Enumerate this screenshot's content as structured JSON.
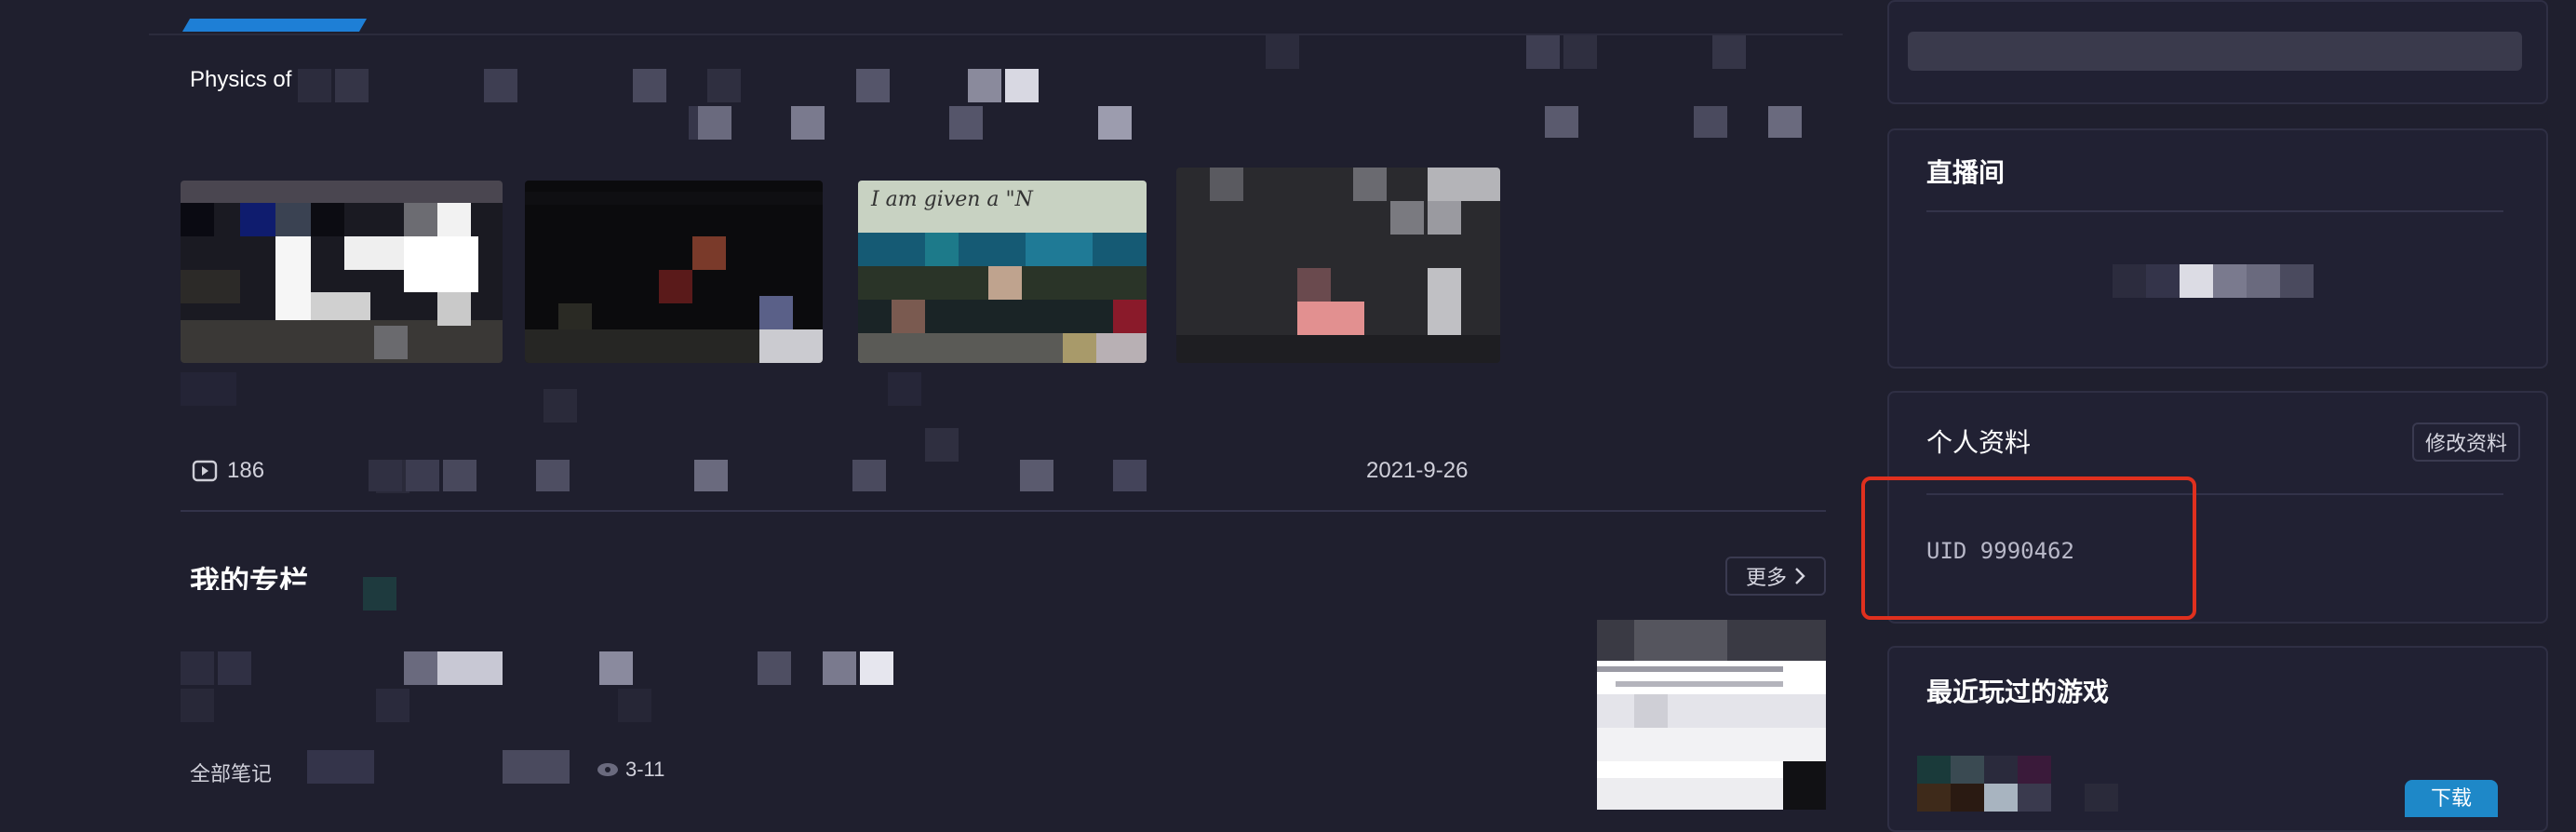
{
  "video_section": {
    "title": "Physics of Li",
    "play_count": "186",
    "date": "2021-9-26",
    "thumb3_handwriting": "I am given a \"N"
  },
  "column_section": {
    "title": "我的专栏",
    "more_label": "更多",
    "all_notes_label": "全部笔记",
    "date": "3-11"
  },
  "sidebar": {
    "live_room": {
      "title": "直播间"
    },
    "profile": {
      "title": "个人资料",
      "edit_label": "修改资料",
      "uid": "UID 9990462"
    },
    "recent_games": {
      "title": "最近玩过的游戏",
      "download_label": "下载"
    }
  },
  "colors": {
    "background": "#1f1f2e",
    "highlight": "#e0301e",
    "accent": "#1e7fd6"
  },
  "icons": {
    "play_count": "play-icon",
    "more_arrow": "chevron-right-icon",
    "views": "eye-icon"
  }
}
